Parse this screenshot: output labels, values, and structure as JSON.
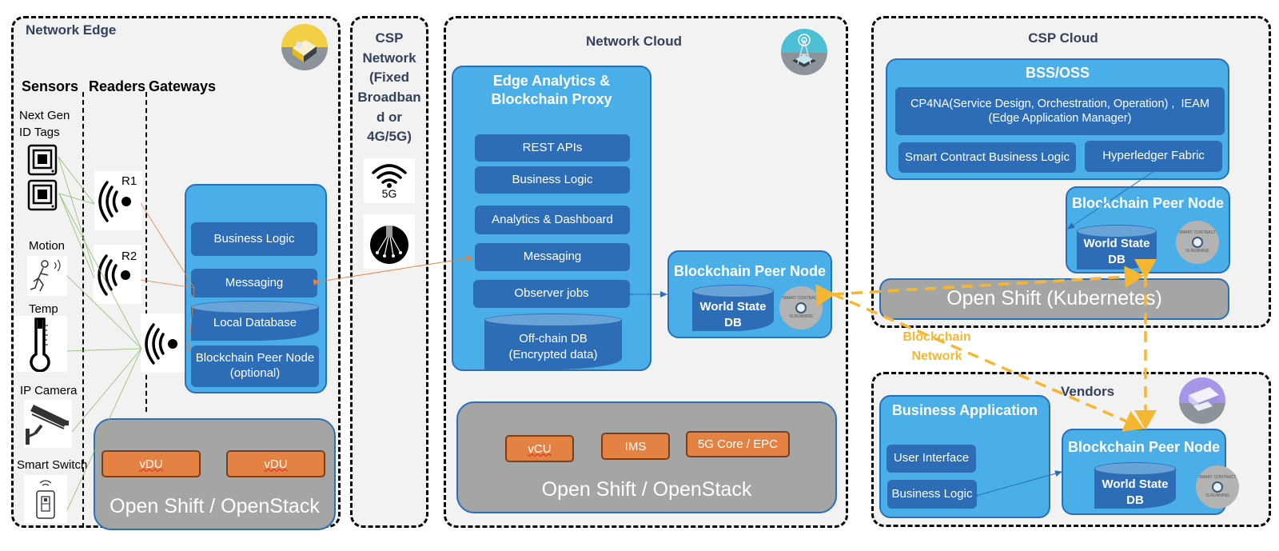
{
  "zones": {
    "network_edge": {
      "title": "Network Edge",
      "columns": [
        "Sensors",
        "Readers",
        "Gateways"
      ],
      "sensors": [
        {
          "label": "Next Gen\nID Tags",
          "icon": "rfid-tag-icon"
        },
        {
          "label": "Motion",
          "icon": "motion-sensor-icon"
        },
        {
          "label": "Temp",
          "icon": "thermometer-icon"
        },
        {
          "label": "IP Camera",
          "icon": "ip-camera-icon"
        },
        {
          "label": "Smart Switch",
          "icon": "smart-switch-icon"
        }
      ],
      "readers": [
        {
          "label": "R1",
          "icon": "wireless-signal-icon"
        },
        {
          "label": "R2",
          "icon": "wireless-signal-icon"
        }
      ],
      "gateway": {
        "components": [
          "Business Logic",
          "Messaging"
        ],
        "database": "Local Database",
        "peer_node": "Blockchain Peer Node\n(optional)"
      },
      "platform": {
        "label": "Open Shift / OpenStack",
        "functions": [
          "vDU",
          "vDU"
        ]
      }
    },
    "csp_network": {
      "title": "CSP\nNetwork\n(Fixed\nBroadban\nd or\n4G/5G)",
      "icons": [
        {
          "name": "5g-wireless-icon",
          "label": "5G"
        },
        {
          "name": "fiber-optic-icon",
          "label": ""
        }
      ]
    },
    "network_cloud": {
      "title": "Network Cloud",
      "proxy": {
        "title": "Edge Analytics &\nBlockchain Proxy",
        "components": [
          "REST APIs",
          "Business Logic",
          "Analytics & Dashboard",
          "Messaging",
          "Observer jobs"
        ],
        "database": "Off-chain DB\n(Encrypted data)"
      },
      "peer_node": {
        "title": "Blockchain Peer Node",
        "database": "World State\nDB",
        "badge": {
          "top": "SMART CONTRACT",
          "bottom": "IS RUNNING"
        }
      },
      "platform": {
        "label": "Open Shift / OpenStack",
        "functions": [
          "vCU",
          "IMS",
          "5G Core / EPC"
        ]
      }
    },
    "csp_cloud": {
      "title": "CSP Cloud",
      "bss_oss": {
        "title": "BSS/OSS",
        "cp4na": "CP4NA(Service Design, Orchestration, Operation) ,  IEAM\n(Edge Application Manager)",
        "components": [
          "Smart Contract Business Logic",
          "Hyperledger Fabric"
        ]
      },
      "peer_node": {
        "title": "Blockchain Peer Node",
        "database": "World State\nDB",
        "badge": {
          "top": "SMART CONTRACT",
          "bottom": "IS RUNNING"
        }
      },
      "platform": {
        "label": "Open Shift (Kubernetes)"
      }
    },
    "vendors": {
      "title": "Vendors",
      "business_app": {
        "title": "Business Application",
        "components": [
          "User Interface",
          "Business Logic"
        ]
      },
      "peer_node": {
        "title": "Blockchain Peer Node",
        "database": "World State\nDB",
        "badge": {
          "top": "SMART CONTRACT",
          "bottom": "IS RUNNING"
        }
      }
    }
  },
  "blockchain_network_label": "Blockchain\nNetwork",
  "colors": {
    "zone_bg": "#f2f2f2",
    "panel_blue": "#4aaee8",
    "box_blue": "#2d6db7",
    "platform_gray": "#a5a5a5",
    "function_orange": "#e38242",
    "blockchain_yellow": "#f5b731",
    "title_slate": "#33415a"
  }
}
